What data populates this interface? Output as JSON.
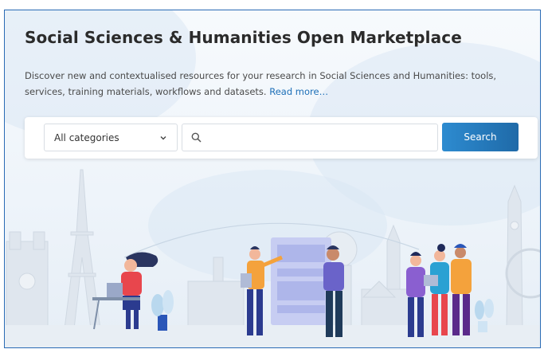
{
  "header": {
    "title": "Social Sciences & Humanities Open Marketplace",
    "description": "Discover new and contextualised resources for your research in Social Sciences and Humanities: tools, services, training materials, workflows and datasets.",
    "read_more": "Read more…"
  },
  "search": {
    "category_selected": "All categories",
    "input_value": "",
    "button_label": "Search"
  },
  "colors": {
    "accent": "#1f6aa8",
    "button_start": "#2d8bd0",
    "link": "#1d6fb8",
    "frame_border": "#2a6bb5"
  },
  "icons": {
    "dropdown": "chevron-down-icon",
    "search": "search-icon"
  }
}
